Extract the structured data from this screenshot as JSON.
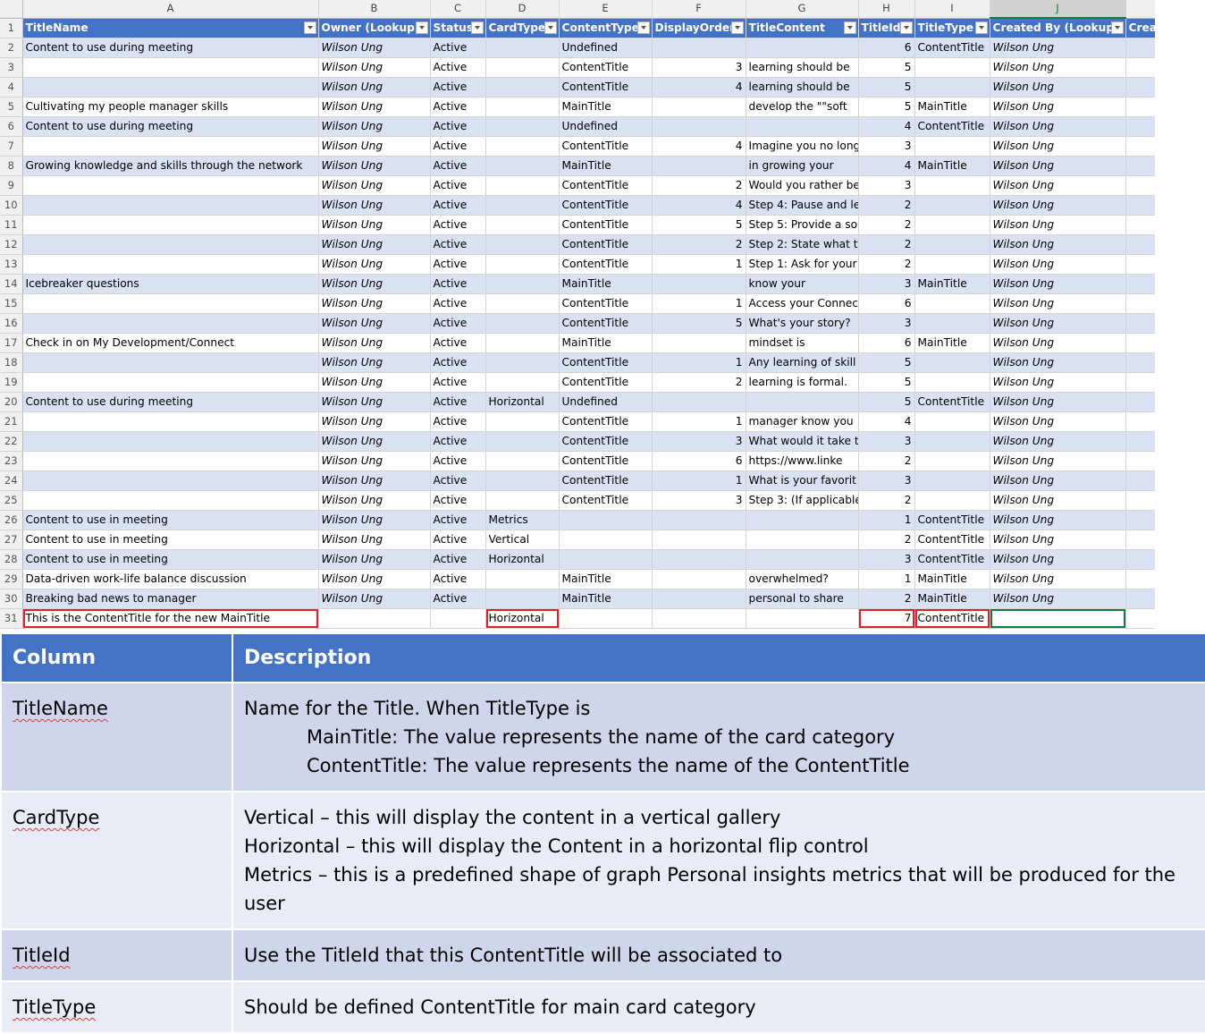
{
  "sheet": {
    "col_letters": [
      "A",
      "B",
      "C",
      "D",
      "E",
      "F",
      "G",
      "H",
      "I",
      "J",
      ""
    ],
    "headers": [
      "TitleName",
      "Owner (Lookup)",
      "Status",
      "CardType",
      "ContentType",
      "DisplayOrder",
      "TitleContent",
      "TitleId",
      "TitleType",
      "Created By (Lookup)",
      "Crea"
    ],
    "rows": [
      {
        "n": "2",
        "v": [
          "Content to use during meeting",
          "Wilson Ung",
          "Active",
          "",
          "Undefined",
          "",
          "",
          "6",
          "ContentTitle",
          "Wilson Ung",
          ""
        ]
      },
      {
        "n": "3",
        "v": [
          "",
          "Wilson Ung",
          "Active",
          "",
          "ContentTitle",
          "3",
          "learning should be",
          "5",
          "",
          "Wilson Ung",
          ""
        ]
      },
      {
        "n": "4",
        "v": [
          "",
          "Wilson Ung",
          "Active",
          "",
          "ContentTitle",
          "4",
          "learning should be",
          "5",
          "",
          "Wilson Ung",
          ""
        ]
      },
      {
        "n": "5",
        "v": [
          "Cultivating my people manager skills",
          "Wilson Ung",
          "Active",
          "",
          "MainTitle",
          "",
          "develop the \"\"soft",
          "5",
          "MainTitle",
          "Wilson Ung",
          ""
        ]
      },
      {
        "n": "6",
        "v": [
          "Content to use during meeting",
          "Wilson Ung",
          "Active",
          "",
          "Undefined",
          "",
          "",
          "4",
          "ContentTitle",
          "Wilson Ung",
          ""
        ]
      },
      {
        "n": "7",
        "v": [
          "",
          "Wilson Ung",
          "Active",
          "",
          "ContentTitle",
          "4",
          "Imagine you no long",
          "3",
          "",
          "Wilson Ung",
          ""
        ]
      },
      {
        "n": "8",
        "v": [
          "Growing knowledge and skills through the network",
          "Wilson Ung",
          "Active",
          "",
          "MainTitle",
          "",
          "in growing your",
          "4",
          "MainTitle",
          "Wilson Ung",
          ""
        ]
      },
      {
        "n": "9",
        "v": [
          "",
          "Wilson Ung",
          "Active",
          "",
          "ContentTitle",
          "2",
          "Would you rather be",
          "3",
          "",
          "Wilson Ung",
          ""
        ]
      },
      {
        "n": "10",
        "v": [
          "",
          "Wilson Ung",
          "Active",
          "",
          "ContentTitle",
          "4",
          "Step 4: Pause and le",
          "2",
          "",
          "Wilson Ung",
          ""
        ]
      },
      {
        "n": "11",
        "v": [
          "",
          "Wilson Ung",
          "Active",
          "",
          "ContentTitle",
          "5",
          "Step 5: Provide a sol",
          "2",
          "",
          "Wilson Ung",
          ""
        ]
      },
      {
        "n": "12",
        "v": [
          "",
          "Wilson Ung",
          "Active",
          "",
          "ContentTitle",
          "2",
          "Step 2: State what th",
          "2",
          "",
          "Wilson Ung",
          ""
        ]
      },
      {
        "n": "13",
        "v": [
          "",
          "Wilson Ung",
          "Active",
          "",
          "ContentTitle",
          "1",
          "Step 1: Ask for your",
          "2",
          "",
          "Wilson Ung",
          ""
        ]
      },
      {
        "n": "14",
        "v": [
          "Icebreaker questions",
          "Wilson Ung",
          "Active",
          "",
          "MainTitle",
          "",
          "know your",
          "3",
          "MainTitle",
          "Wilson Ung",
          ""
        ]
      },
      {
        "n": "15",
        "v": [
          "",
          "Wilson Ung",
          "Active",
          "",
          "ContentTitle",
          "1",
          "Access your Connec",
          "6",
          "",
          "Wilson Ung",
          ""
        ]
      },
      {
        "n": "16",
        "v": [
          "",
          "Wilson Ung",
          "Active",
          "",
          "ContentTitle",
          "5",
          "What's your story?",
          "3",
          "",
          "Wilson Ung",
          ""
        ]
      },
      {
        "n": "17",
        "v": [
          "Check in on My Development/Connect",
          "Wilson Ung",
          "Active",
          "",
          "MainTitle",
          "",
          "mindset is",
          "6",
          "MainTitle",
          "Wilson Ung",
          ""
        ]
      },
      {
        "n": "18",
        "v": [
          "",
          "Wilson Ung",
          "Active",
          "",
          "ContentTitle",
          "1",
          "Any learning of skill",
          "5",
          "",
          "Wilson Ung",
          ""
        ]
      },
      {
        "n": "19",
        "v": [
          "",
          "Wilson Ung",
          "Active",
          "",
          "ContentTitle",
          "2",
          "learning is formal.",
          "5",
          "",
          "Wilson Ung",
          ""
        ]
      },
      {
        "n": "20",
        "v": [
          "Content to use during meeting",
          "Wilson Ung",
          "Active",
          "Horizontal",
          "Undefined",
          "",
          "",
          "5",
          "ContentTitle",
          "Wilson Ung",
          ""
        ]
      },
      {
        "n": "21",
        "v": [
          "",
          "Wilson Ung",
          "Active",
          "",
          "ContentTitle",
          "1",
          "manager know you",
          "4",
          "",
          "Wilson Ung",
          ""
        ]
      },
      {
        "n": "22",
        "v": [
          "",
          "Wilson Ung",
          "Active",
          "",
          "ContentTitle",
          "3",
          "What would it take t",
          "3",
          "",
          "Wilson Ung",
          ""
        ]
      },
      {
        "n": "23",
        "v": [
          "",
          "Wilson Ung",
          "Active",
          "",
          "ContentTitle",
          "6",
          "https://www.linke",
          "2",
          "",
          "Wilson Ung",
          ""
        ]
      },
      {
        "n": "24",
        "v": [
          "",
          "Wilson Ung",
          "Active",
          "",
          "ContentTitle",
          "1",
          "What is your favorit",
          "3",
          "",
          "Wilson Ung",
          ""
        ]
      },
      {
        "n": "25",
        "v": [
          "",
          "Wilson Ung",
          "Active",
          "",
          "ContentTitle",
          "3",
          "Step 3: (If applicable",
          "2",
          "",
          "Wilson Ung",
          ""
        ]
      },
      {
        "n": "26",
        "v": [
          "Content to use in meeting",
          "Wilson Ung",
          "Active",
          "Metrics",
          "",
          "",
          "",
          "1",
          "ContentTitle",
          "Wilson Ung",
          ""
        ]
      },
      {
        "n": "27",
        "v": [
          "Content to use in meeting",
          "Wilson Ung",
          "Active",
          "Vertical",
          "",
          "",
          "",
          "2",
          "ContentTitle",
          "Wilson Ung",
          ""
        ]
      },
      {
        "n": "28",
        "v": [
          "Content to use in meeting",
          "Wilson Ung",
          "Active",
          "Horizontal",
          "",
          "",
          "",
          "3",
          "ContentTitle",
          "Wilson Ung",
          ""
        ]
      },
      {
        "n": "29",
        "v": [
          "Data-driven work-life balance discussion",
          "Wilson Ung",
          "Active",
          "",
          "MainTitle",
          "",
          "overwhelmed?",
          "1",
          "MainTitle",
          "Wilson Ung",
          ""
        ]
      },
      {
        "n": "30",
        "v": [
          "Breaking bad news to manager",
          "Wilson Ung",
          "Active",
          "",
          "MainTitle",
          "",
          "personal to share",
          "2",
          "MainTitle",
          "Wilson Ung",
          ""
        ]
      },
      {
        "n": "31",
        "v": [
          "This is the ContentTitle for the new MainTitle",
          "",
          "",
          "Horizontal",
          "",
          "",
          "",
          "7",
          "ContentTitle",
          "",
          ""
        ]
      }
    ]
  },
  "description_table": {
    "headers": {
      "column": "Column",
      "description": "Description"
    },
    "rows": [
      {
        "column": "TitleName",
        "lines": [
          "Name for the Title. When TitleType is",
          "MainTitle: The value represents the name of the card category",
          "ContentTitle: The value represents the name of the ContentTitle"
        ]
      },
      {
        "column": "CardType",
        "lines": [
          "Vertical – this will display the content in a vertical gallery",
          "Horizontal – this will display the Content in a horizontal flip control",
          "Metrics – this is a predefined shape of graph Personal insights metrics that will be produced for the user"
        ]
      },
      {
        "column": "TitleId",
        "lines": [
          "Use the TitleId that this ContentTitle will be associated to"
        ]
      },
      {
        "column": "TitleType",
        "lines": [
          "Should be defined ContentTitle for main card category"
        ]
      }
    ]
  },
  "colors": {
    "header_blue": "#4472c4",
    "band_blue": "#d9e1f2",
    "highlight_red": "#e0202a",
    "excel_green": "#107c41"
  }
}
